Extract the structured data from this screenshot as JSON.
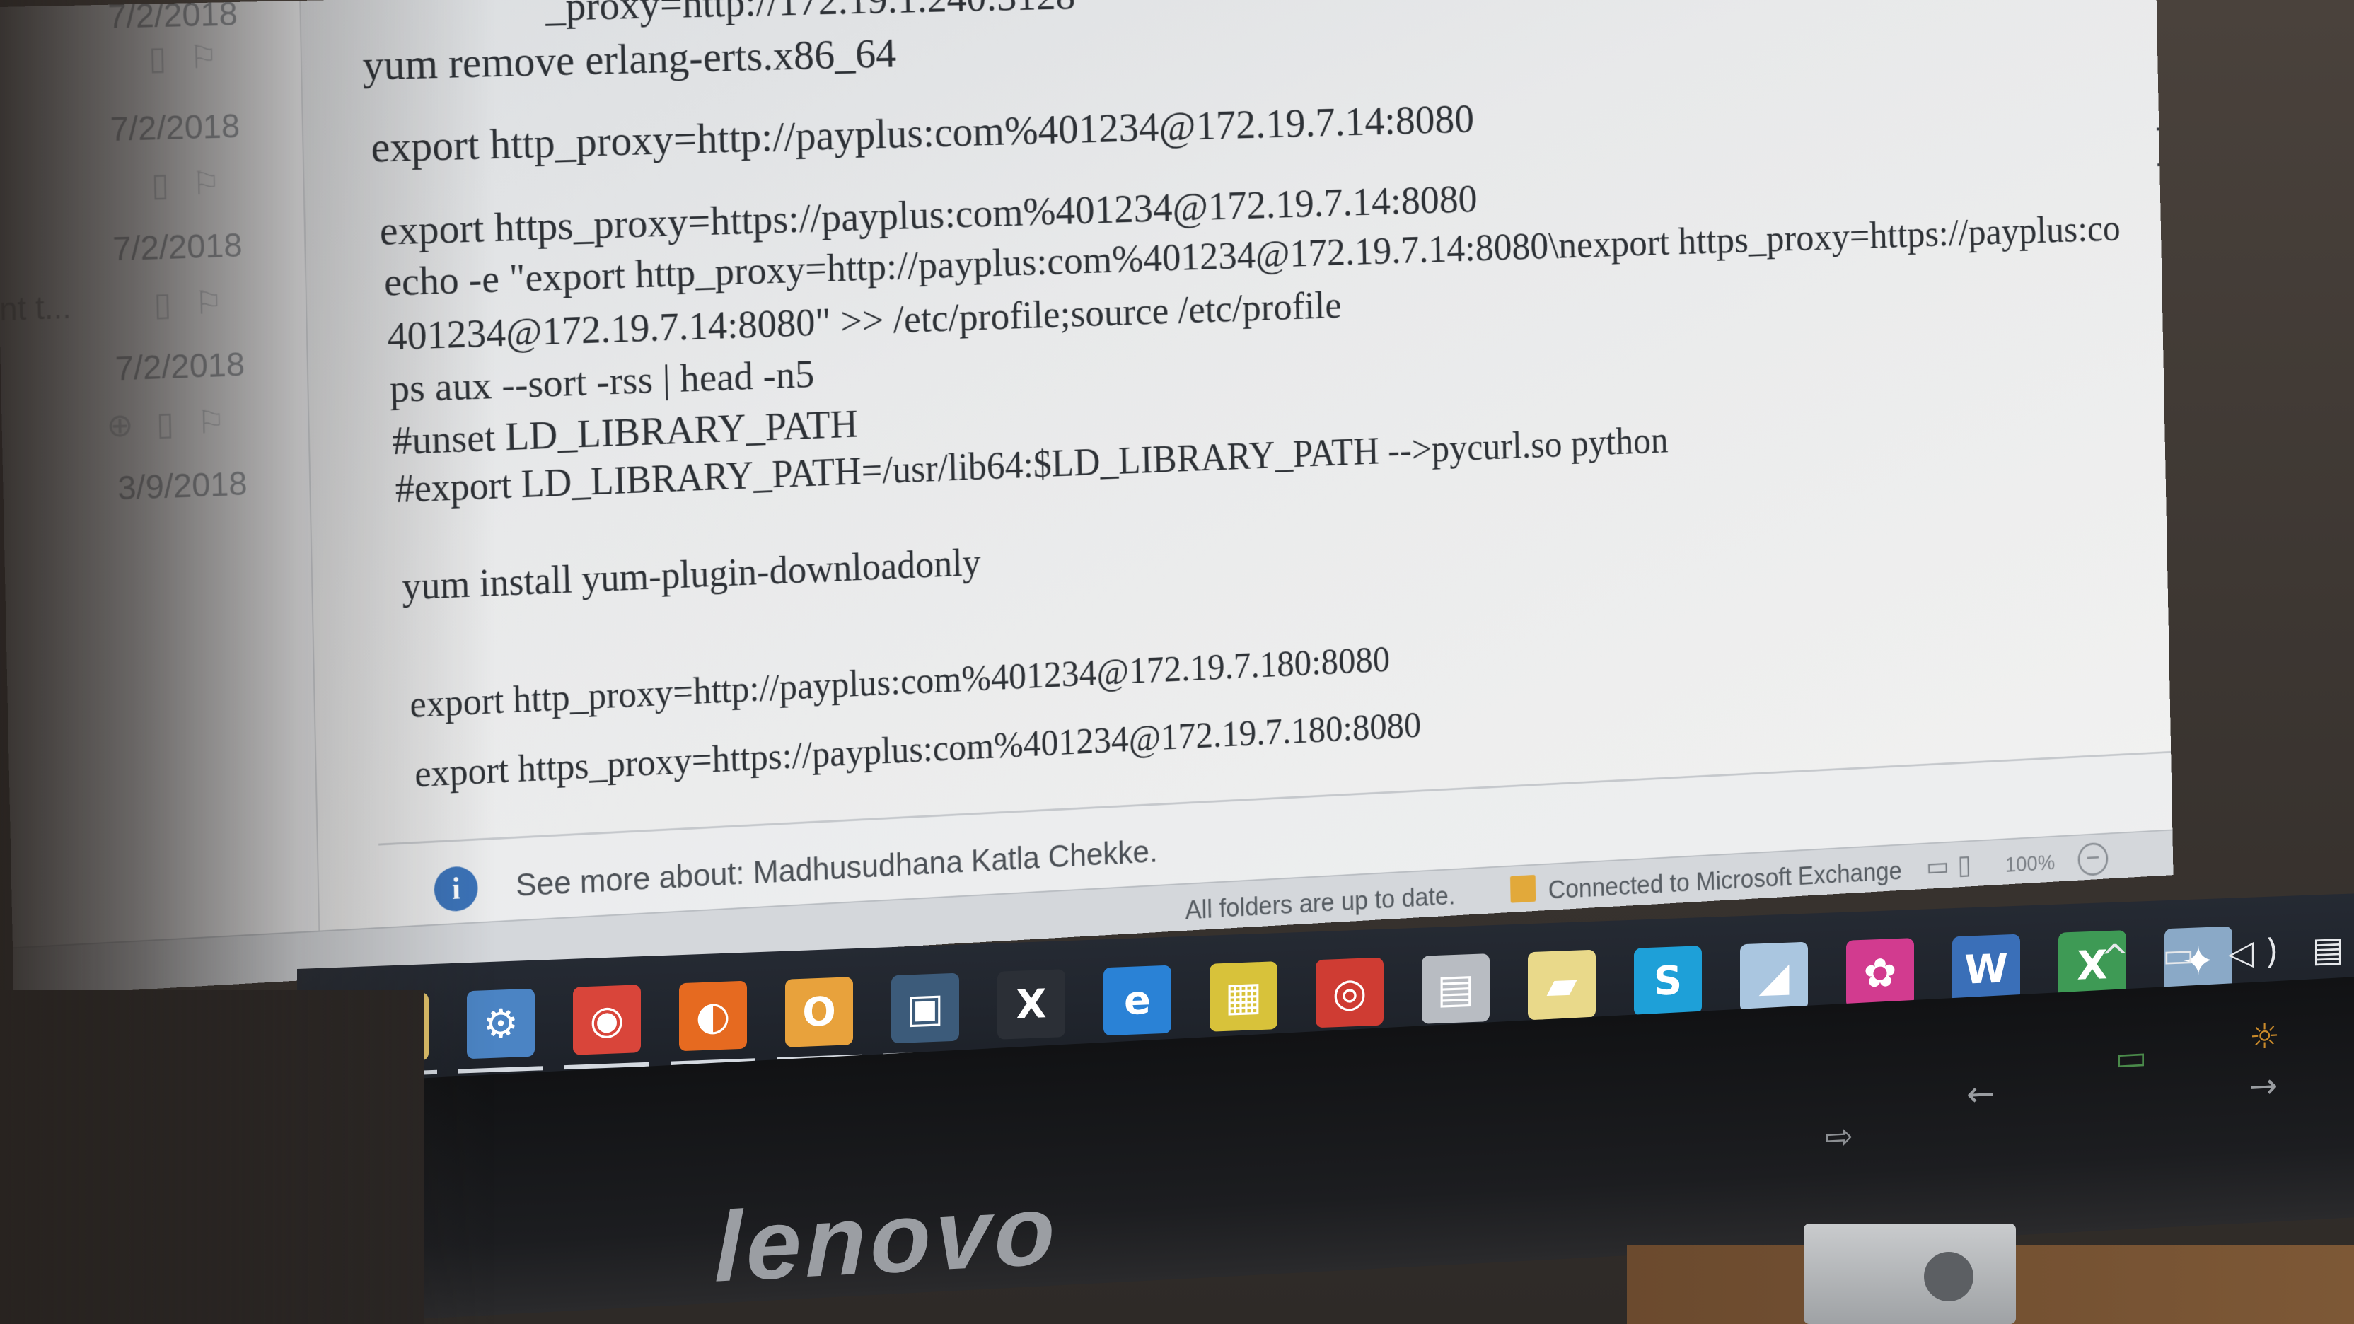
{
  "message_list": {
    "rows": [
      {
        "date": "7/2/2018",
        "icons": "▯ ⚐"
      },
      {
        "date": "7/2/2018",
        "icons": "▯ ⚐"
      },
      {
        "date": "7/2/2018",
        "icons": "▯ ⚐",
        "snippet": "nt t..."
      },
      {
        "date": "7/2/2018",
        "icons": "⊕ ▯ ⚐"
      },
      {
        "date": "3/9/2018",
        "icons": ""
      }
    ]
  },
  "email_body": {
    "lines": [
      "_proxy=http://172.19.1.240:3128",
      "yum remove erlang-erts.x86_64",
      "export http_proxy=http://payplus:com%401234@172.19.7.14:8080",
      "export https_proxy=https://payplus:com%401234@172.19.7.14:8080",
      "echo -e  \"export http_proxy=http://payplus:com%401234@172.19.7.14:8080\\nexport https_proxy=https://payplus:co",
      "401234@172.19.7.14:8080\" >> /etc/profile;source /etc/profile",
      "ps aux --sort -rss | head -n5",
      "#unset LD_LIBRARY_PATH",
      "#export LD_LIBRARY_PATH=/usr/lib64:$LD_LIBRARY_PATH  -->pycurl.so python",
      "yum install yum-plugin-downloadonly",
      "export http_proxy=http://payplus:com%401234@172.19.7.180:8080",
      "export https_proxy=https://payplus:com%401234@172.19.7.180:8080"
    ]
  },
  "info_bar": {
    "icon": "i",
    "text": "See more about: Madhusudhana Katla Chekke."
  },
  "status_bar": {
    "sync_status": "All folders are up to date.",
    "connection_status": "Connected to Microsoft Exchange",
    "zoom": "100%",
    "zoom_out": "−"
  },
  "taskbar": {
    "apps": [
      {
        "name": "file-explorer",
        "glyph": "▭",
        "color": "#e3c26a"
      },
      {
        "name": "network",
        "glyph": "⚙",
        "color": "#4b84c4"
      },
      {
        "name": "chrome",
        "glyph": "◉",
        "color": "#d9453a"
      },
      {
        "name": "firefox",
        "glyph": "◐",
        "color": "#e66a20"
      },
      {
        "name": "outlook",
        "glyph": "O",
        "color": "#e8a23c"
      },
      {
        "name": "remote-desktop",
        "glyph": "▣",
        "color": "#3c5b7a"
      },
      {
        "name": "xming",
        "glyph": "X",
        "color": "#2b2f36"
      },
      {
        "name": "internet-explorer",
        "glyph": "e",
        "color": "#2a82d6"
      },
      {
        "name": "filezilla",
        "glyph": "▦",
        "color": "#d8c23a"
      },
      {
        "name": "vlc-like",
        "glyph": "◎",
        "color": "#cf3c33"
      },
      {
        "name": "printer",
        "glyph": "▤",
        "color": "#b8bcc2"
      },
      {
        "name": "folder",
        "glyph": "▰",
        "color": "#e9d98a"
      },
      {
        "name": "skype",
        "glyph": "S",
        "color": "#1ea0d8"
      },
      {
        "name": "notes",
        "glyph": "◢",
        "color": "#aac6e0"
      },
      {
        "name": "settings-app",
        "glyph": "✿",
        "color": "#d23b8f"
      },
      {
        "name": "word",
        "glyph": "W",
        "color": "#3a6fb8"
      },
      {
        "name": "excel",
        "glyph": "X",
        "color": "#3e9a55"
      },
      {
        "name": "network-tool",
        "glyph": "✦",
        "color": "#8aa9c7"
      }
    ],
    "tray": "^ ▭ ◁) ▤"
  },
  "monitor": {
    "brand": "lenovo"
  }
}
